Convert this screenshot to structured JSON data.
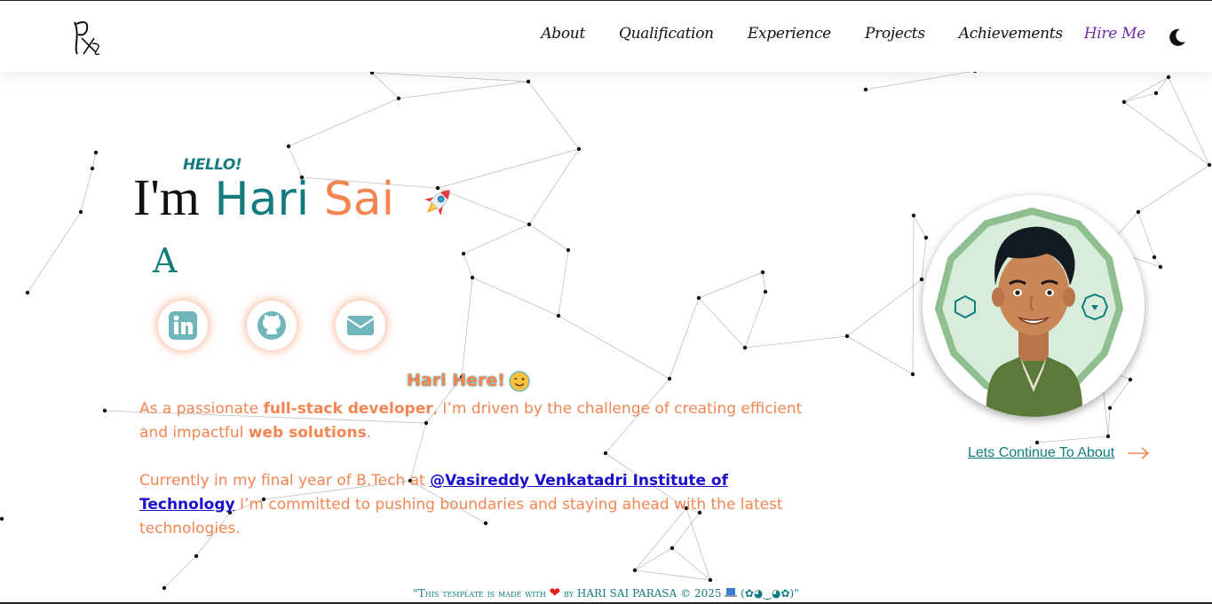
{
  "header": {
    "logo_text": "PKS",
    "nav": [
      "About",
      "Qualification",
      "Experience",
      "Projects",
      "Achievements"
    ],
    "hire_label": "Hire Me",
    "theme_icon": "moon-icon"
  },
  "hero": {
    "hello": "HELLO!",
    "im": "I'm",
    "first_name": "Hari",
    "last_name": "Sai",
    "typed_text": "A",
    "rocket_icon": "rocket-icon",
    "social": [
      "linkedin-icon",
      "github-icon",
      "mail-icon"
    ]
  },
  "about": {
    "title": "Hari Here!",
    "emoji_icon": "winking-face-icon",
    "p1_a": "As a passionate ",
    "p1_b": "full-stack developer",
    "p1_c": ", I’m driven by the challenge of creating efficient and impactful ",
    "p1_d": "web solutions",
    "p1_e": ".",
    "p2_a": "Currently in my final year of B.Tech at ",
    "p2_link": "@Vasireddy Venkatadri Institute of Technology",
    "p2_b": " I’m committed to pushing boundaries and staying ahead with the latest technologies."
  },
  "cta": {
    "continue_label": "Lets Continue To About"
  },
  "footer": {
    "prefix": "\"This template is made with",
    "by": "by",
    "name": "HARI SAI PARASA",
    "copyright": "© 2025",
    "suffix": "(✿◕‿◕✿)\""
  },
  "colors": {
    "teal": "#127c7f",
    "orange": "#f28552",
    "purple": "#6b2fa6",
    "link": "#1a0dcc"
  }
}
